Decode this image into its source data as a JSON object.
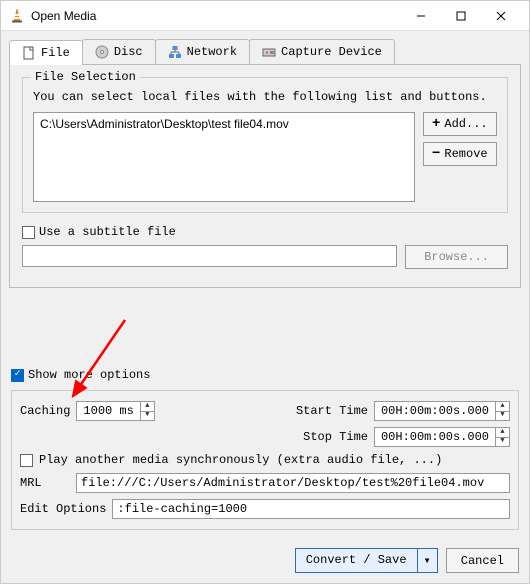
{
  "window": {
    "title": "Open Media"
  },
  "tabs": {
    "file": "File",
    "disc": "Disc",
    "network": "Network",
    "capture": "Capture Device"
  },
  "file_selection": {
    "legend": "File Selection",
    "help": "You can select local files with the following list and buttons.",
    "items": [
      "C:\\Users\\Administrator\\Desktop\\test file04.mov"
    ],
    "add_btn": "Add...",
    "remove_btn": "Remove"
  },
  "subtitle": {
    "label": "Use a subtitle file",
    "browse_btn": "Browse..."
  },
  "more_options": {
    "label": "Show more options"
  },
  "options": {
    "caching_label": "Caching",
    "caching_value": "1000 ms",
    "start_label": "Start Time",
    "start_value": "00H:00m:00s.000",
    "stop_label": "Stop Time",
    "stop_value": "00H:00m:00s.000",
    "play_sync_label": "Play another media synchronously (extra audio file, ...)",
    "mrl_label": "MRL",
    "mrl_value": "file:///C:/Users/Administrator/Desktop/test%20file04.mov",
    "edit_label": "Edit Options",
    "edit_value": ":file-caching=1000"
  },
  "footer": {
    "convert_btn": "Convert / Save",
    "cancel_btn": "Cancel"
  }
}
